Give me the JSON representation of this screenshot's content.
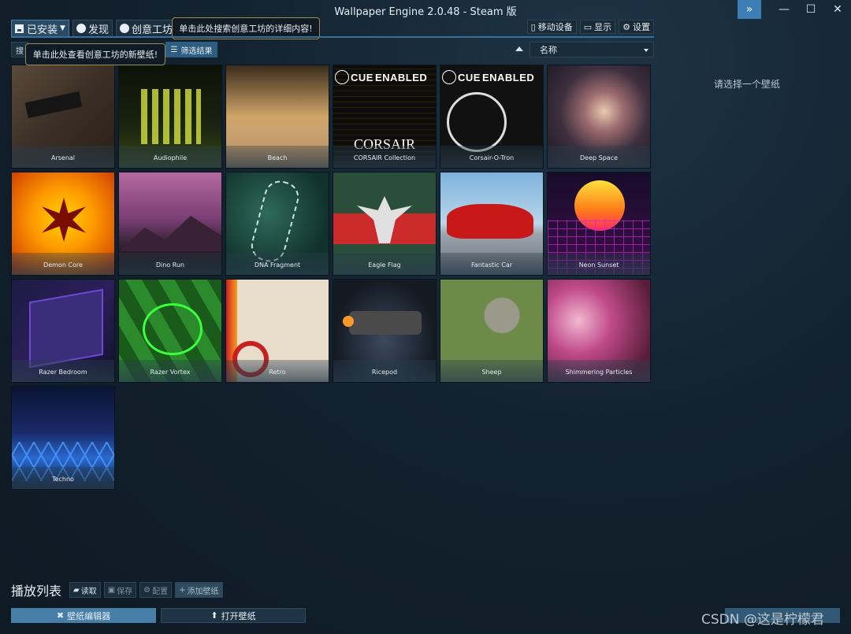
{
  "window": {
    "title": "Wallpaper Engine 2.0.48 - Steam 版",
    "expand_icon": "double-chevron-right-icon",
    "min_glyph": "—",
    "max_glyph": "☐",
    "close_glyph": "✕"
  },
  "toolbar": {
    "installed_label": "已安装",
    "discover_label": "发现",
    "workshop_label": "创意工坊",
    "workshop_tooltip": "单击此处搜索创意工坊的详细内容!",
    "discover_tooltip": "单击此处查看创意工坊的新壁纸!",
    "mobile_label": "移动设备",
    "display_label": "显示",
    "settings_label": "设置"
  },
  "filter": {
    "search_partial": "搜",
    "filter_results_label": "筛选结果",
    "sort_label": "名称"
  },
  "wallpapers": [
    {
      "name": "Arsenal"
    },
    {
      "name": "Audiophile"
    },
    {
      "name": "Beach"
    },
    {
      "name": "CORSAIR Collection"
    },
    {
      "name": "Corsair-O-Tron"
    },
    {
      "name": "Deep Space"
    },
    {
      "name": "Demon Core"
    },
    {
      "name": "Dino Run"
    },
    {
      "name": "DNA Fragment"
    },
    {
      "name": "Eagle Flag"
    },
    {
      "name": "Fantastic Car"
    },
    {
      "name": "Neon Sunset"
    },
    {
      "name": "Razer Bedroom"
    },
    {
      "name": "Razer Vortex"
    },
    {
      "name": "Retro"
    },
    {
      "name": "Ricepod"
    },
    {
      "name": "Sheep"
    },
    {
      "name": "Shimmering Particles"
    },
    {
      "name": "Techno"
    }
  ],
  "cue": {
    "text": "CUE",
    "enabled": "ENABLED",
    "corsair": "CORSAIR"
  },
  "right_panel": {
    "prompt": "请选择一个壁纸"
  },
  "playlist": {
    "title": "播放列表",
    "load_label": "读取",
    "save_label": "保存",
    "config_label": "配置",
    "add_label": "添加壁纸"
  },
  "bottom": {
    "editor_label": "壁纸编辑器",
    "open_label": "打开壁纸",
    "watermark": "CSDN @这是柠檬君"
  }
}
